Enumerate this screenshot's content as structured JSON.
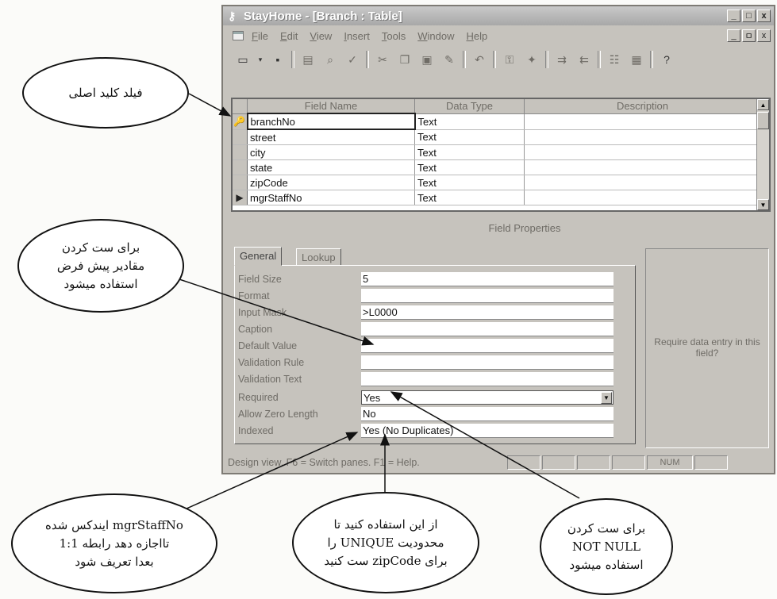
{
  "window": {
    "title": "StayHome - [Branch : Table]",
    "buttons": [
      "_",
      "□",
      "x"
    ]
  },
  "menu": {
    "items": [
      "File",
      "Edit",
      "View",
      "Insert",
      "Tools",
      "Window",
      "Help"
    ],
    "buttons": [
      "_",
      "ㅁ",
      "x"
    ]
  },
  "toolbar": {
    "icons": [
      "view-icon",
      "dropdown-icon",
      "save-icon",
      "print-icon",
      "preview-icon",
      "spell-icon",
      "cut-icon",
      "copy-icon",
      "paste-icon",
      "format-painter-icon",
      "undo-icon",
      "primary-key-icon",
      "build-icon",
      "insert-row-icon",
      "delete-row-icon",
      "properties-icon",
      "database-window-icon",
      "help-icon"
    ]
  },
  "grid": {
    "columns": [
      "Field Name",
      "Data Type",
      "Description"
    ],
    "rows": [
      {
        "selector": "🔑",
        "name": "branchNo",
        "type": "Text",
        "desc": ""
      },
      {
        "selector": "",
        "name": "street",
        "type": "Text",
        "desc": ""
      },
      {
        "selector": "",
        "name": "city",
        "type": "Text",
        "desc": ""
      },
      {
        "selector": "",
        "name": "state",
        "type": "Text",
        "desc": ""
      },
      {
        "selector": "",
        "name": "zipCode",
        "type": "Text",
        "desc": ""
      },
      {
        "selector": "▶",
        "name": "mgrStaffNo",
        "type": "Text",
        "desc": ""
      }
    ]
  },
  "field_properties": {
    "title": "Field Properties",
    "tabs": [
      "General",
      "Lookup"
    ],
    "rows": [
      {
        "label": "Field Size",
        "value": "5"
      },
      {
        "label": "Format",
        "value": ""
      },
      {
        "label": "Input Mask",
        "value": ">L0000"
      },
      {
        "label": "Caption",
        "value": ""
      },
      {
        "label": "Default Value",
        "value": ""
      },
      {
        "label": "Validation Rule",
        "value": ""
      },
      {
        "label": "Validation Text",
        "value": ""
      },
      {
        "label": "Required",
        "value": "Yes"
      },
      {
        "label": "Allow Zero Length",
        "value": "No"
      },
      {
        "label": "Indexed",
        "value": "Yes (No Duplicates)"
      }
    ],
    "help_text": "Require data entry in this field?"
  },
  "status": {
    "text": "Design view.  F6 = Switch panes.  F1 = Help.",
    "num": "NUM"
  },
  "annotations": {
    "primary_key": "فیلد کلید اصلی",
    "default_value": "برای ست کردن\nمقادیر پیش فرض\nاستفاده میشود",
    "index": "mgrStaffNo ایندکس شده\nتااجازه دهد رابطه 1:1\nبعدا تعریف شود",
    "unique": "از این استفاده کنید تا\nمحدودیت UNIQUE را\nبرای zipCode ست کنید",
    "not_null": "برای ست کردن\nNOT NULL\nاستفاده میشود"
  }
}
